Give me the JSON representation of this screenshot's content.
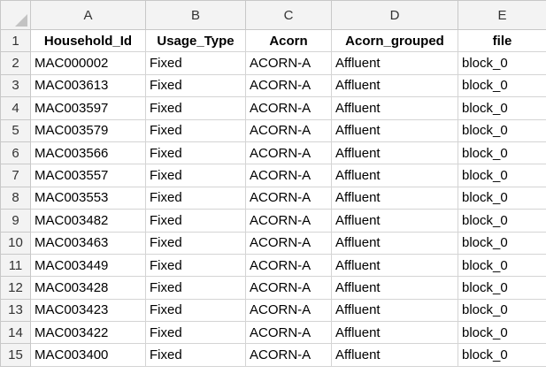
{
  "columns": [
    "A",
    "B",
    "C",
    "D",
    "E"
  ],
  "row_numbers": [
    "1",
    "2",
    "3",
    "4",
    "5",
    "6",
    "7",
    "8",
    "9",
    "10",
    "11",
    "12",
    "13",
    "14",
    "15"
  ],
  "headers": [
    "Household_Id",
    "Usage_Type",
    "Acorn",
    "Acorn_grouped",
    "file"
  ],
  "rows": [
    [
      "MAC000002",
      "Fixed",
      "ACORN-A",
      "Affluent",
      "block_0"
    ],
    [
      "MAC003613",
      "Fixed",
      "ACORN-A",
      "Affluent",
      "block_0"
    ],
    [
      "MAC003597",
      "Fixed",
      "ACORN-A",
      "Affluent",
      "block_0"
    ],
    [
      "MAC003579",
      "Fixed",
      "ACORN-A",
      "Affluent",
      "block_0"
    ],
    [
      "MAC003566",
      "Fixed",
      "ACORN-A",
      "Affluent",
      "block_0"
    ],
    [
      "MAC003557",
      "Fixed",
      "ACORN-A",
      "Affluent",
      "block_0"
    ],
    [
      "MAC003553",
      "Fixed",
      "ACORN-A",
      "Affluent",
      "block_0"
    ],
    [
      "MAC003482",
      "Fixed",
      "ACORN-A",
      "Affluent",
      "block_0"
    ],
    [
      "MAC003463",
      "Fixed",
      "ACORN-A",
      "Affluent",
      "block_0"
    ],
    [
      "MAC003449",
      "Fixed",
      "ACORN-A",
      "Affluent",
      "block_0"
    ],
    [
      "MAC003428",
      "Fixed",
      "ACORN-A",
      "Affluent",
      "block_0"
    ],
    [
      "MAC003423",
      "Fixed",
      "ACORN-A",
      "Affluent",
      "block_0"
    ],
    [
      "MAC003422",
      "Fixed",
      "ACORN-A",
      "Affluent",
      "block_0"
    ],
    [
      "MAC003400",
      "Fixed",
      "ACORN-A",
      "Affluent",
      "block_0"
    ]
  ],
  "colors": {
    "header_bg": "#f3f3f3",
    "gridline": "#d4d4d4",
    "select_all_triangle": "#c3c3c3"
  }
}
